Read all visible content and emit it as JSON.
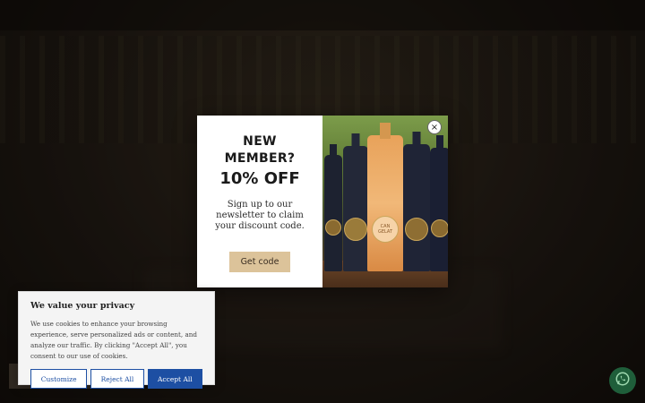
{
  "popup": {
    "heading_line1": "NEW",
    "heading_line2": "MEMBER?",
    "discount": "10% OFF",
    "body": "Sign up to our newsletter to claim your discount code.",
    "cta_label": "Get code",
    "close_symbol": "×",
    "bottle_label_text": "CAN GELAT"
  },
  "cookie_banner": {
    "title": "We value your privacy",
    "text": "We use cookies to enhance your browsing experience, serve personalized ads or content, and analyze our traffic. By clicking \"Accept All\", you consent to our use of cookies.",
    "customize_label": "Customize",
    "reject_label": "Reject All",
    "accept_label": "Accept All"
  },
  "icons": {
    "close": "close-icon",
    "whatsapp": "whatsapp-icon"
  },
  "colors": {
    "cta_bg": "#dcc39a",
    "cookie_primary": "#1d4fa3",
    "whatsapp_bg": "#1f5e3a",
    "overlay": "#1c1714"
  }
}
